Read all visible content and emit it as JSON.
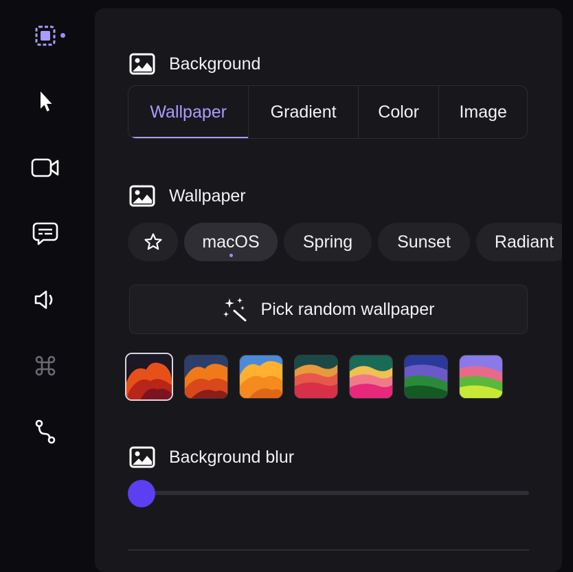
{
  "sidebar": {
    "items": [
      {
        "name": "background",
        "icon": "selection-frame-icon",
        "active": true
      },
      {
        "name": "cursor",
        "icon": "cursor-arrow-icon"
      },
      {
        "name": "camera",
        "icon": "video-camera-icon"
      },
      {
        "name": "captions",
        "icon": "caption-bubble-icon"
      },
      {
        "name": "audio",
        "icon": "speaker-icon"
      },
      {
        "name": "shortcuts",
        "icon": "command-key-icon",
        "disabled": true
      },
      {
        "name": "path",
        "icon": "bezier-path-icon"
      }
    ]
  },
  "background": {
    "title": "Background",
    "tabs": [
      {
        "label": "Wallpaper",
        "active": true
      },
      {
        "label": "Gradient"
      },
      {
        "label": "Color"
      },
      {
        "label": "Image"
      }
    ]
  },
  "wallpaper": {
    "title": "Wallpaper",
    "categories": [
      {
        "label": "",
        "icon": "star-icon"
      },
      {
        "label": "macOS",
        "active": true
      },
      {
        "label": "Spring"
      },
      {
        "label": "Sunset"
      },
      {
        "label": "Radiant"
      }
    ],
    "random_label": "Pick random wallpaper",
    "thumbnails": [
      {
        "id": "sonoma-red",
        "selected": true
      },
      {
        "id": "ventura-orange"
      },
      {
        "id": "ventura-light"
      },
      {
        "id": "sonoma-wave"
      },
      {
        "id": "sonoma-pink"
      },
      {
        "id": "sonoma-green-dark"
      },
      {
        "id": "sonoma-green-light"
      }
    ]
  },
  "blur": {
    "title": "Background blur",
    "value": 0,
    "accent": "#5b3ff0"
  },
  "colors": {
    "accent": "#a99cff",
    "panel": "#18181c"
  }
}
